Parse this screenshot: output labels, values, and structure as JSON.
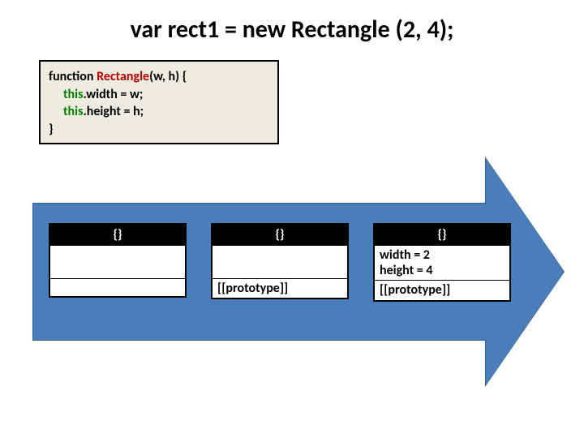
{
  "title": {
    "var_decl": "var rect1 = ",
    "new_kw": "new",
    "call": "  Rectangle (2, 4);"
  },
  "code": {
    "line1_pre": "function ",
    "line1_cls": "Rectangle",
    "line1_post": "(w, h) {",
    "line2_this": "this",
    "line2_rest": ".width = w;",
    "line3_this": "this",
    "line3_rest": ".height = h;",
    "line4": "}"
  },
  "boxes": [
    {
      "header": "{}",
      "props": "",
      "proto": ""
    },
    {
      "header": "{}",
      "props": "",
      "proto": "[[prototype]]"
    },
    {
      "header": "{}",
      "props": "width = 2\nheight = 4",
      "proto": "[[prototype]]"
    }
  ]
}
